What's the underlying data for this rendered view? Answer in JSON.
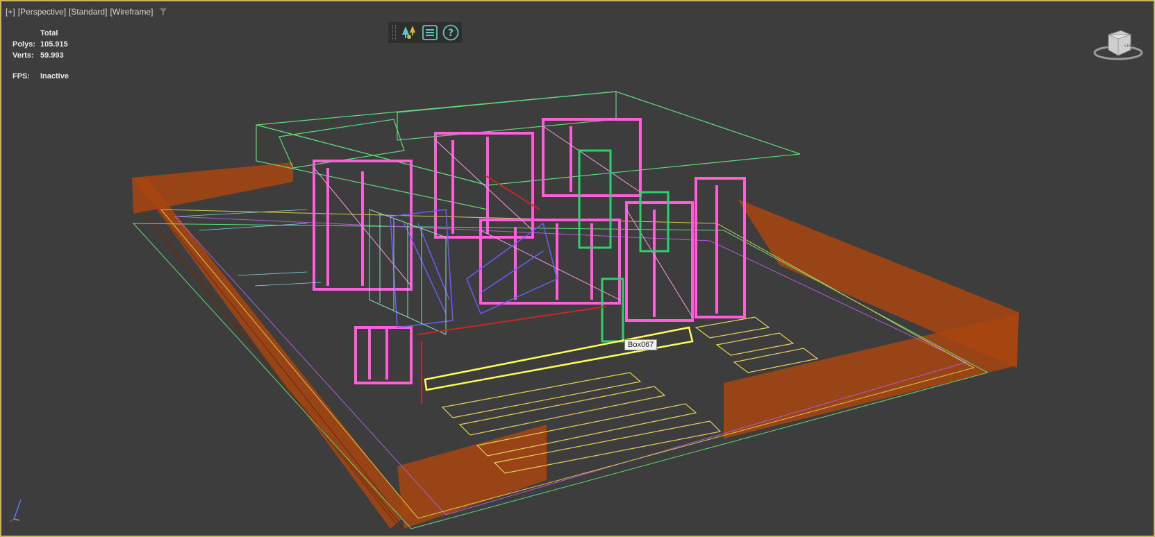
{
  "viewport": {
    "labels": [
      "[+]",
      "[Perspective]",
      "[Standard]",
      "[Wireframe]"
    ]
  },
  "stats": {
    "header": "Total",
    "polys_label": "Polys:",
    "polys_value": "105.915",
    "verts_label": "Verts:",
    "verts_value": "59.993",
    "fps_label": "FPS:",
    "fps_value": "Inactive"
  },
  "toolbar": {
    "icons": [
      "scene-explorer-icon",
      "menu-icon",
      "help-icon"
    ]
  },
  "viewcube": {
    "label": "LEFT"
  },
  "tooltip": {
    "text": "Box067"
  },
  "colors": {
    "viewport_border": "#c9b65a",
    "fence": "#b24a14",
    "walls": "#ff5fd6",
    "highlight": "#ffff55",
    "green_wire": "#5cdc7a",
    "blue_wire": "#6a5cff"
  }
}
